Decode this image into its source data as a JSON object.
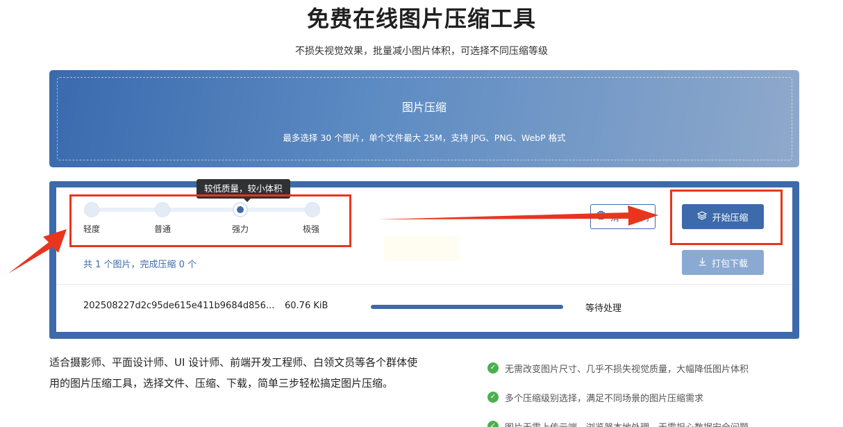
{
  "header": {
    "title": "免费在线图片压缩工具",
    "subtitle": "不损失视觉效果，批量减小图片体积，可选择不同压缩等级"
  },
  "upload": {
    "title": "图片压缩",
    "hint": "最多选择 30 个图片，单个文件最大 25M，支持 JPG、PNG、WebP 格式"
  },
  "compression": {
    "levels": [
      "轻度",
      "普通",
      "强力",
      "极强"
    ],
    "selected_level": "强力",
    "tooltip": "较低质量，较小体积"
  },
  "summary": {
    "count_text": "共 1 个图片，完成压缩 0 个"
  },
  "actions": {
    "clear_label": "清空队列",
    "clear_label_visible": "清    队列",
    "start_label": "开始压缩",
    "download_label": "打包下载"
  },
  "files": [
    {
      "name": "202508227d2c95de615e411b9684d856...",
      "size": "60.76 KiB",
      "progress": 1.0,
      "status": "等待处理"
    }
  ],
  "description": "适合摄影师、平面设计师、UI 设计师、前端开发工程师、白领文员等各个群体使用的图片压缩工具，选择文件、压缩、下载，简单三步轻松搞定图片压缩。",
  "features": [
    "无需改变图片尺寸、几乎不损失视觉质量，大幅降低图片体积",
    "多个压缩级别选择，满足不同场景的图片压缩需求",
    "图片无需上传云端，浏览器本地处理，无需担心数据安全问题"
  ],
  "colors": {
    "primary": "#3d6aab",
    "annotation_red": "#e8351e",
    "check_green": "#4caf50"
  }
}
